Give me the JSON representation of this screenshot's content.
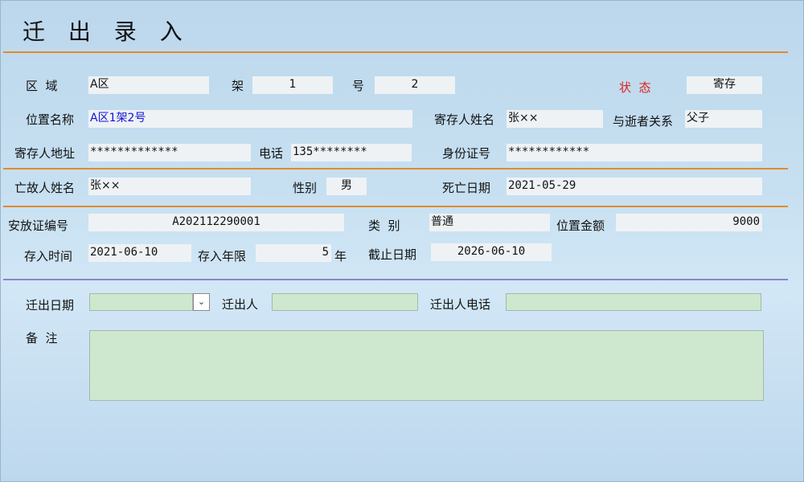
{
  "title": "迁 出 录 入",
  "row1": {
    "area_label": "区  域",
    "area_value": "A区",
    "shelf_label": "架",
    "shelf_value": "1",
    "number_label": "号",
    "number_value": "2",
    "status_label": "状  态",
    "status_value": "寄存"
  },
  "row2": {
    "position_label": "位置名称",
    "position_value": "A区1架2号",
    "depositor_label": "寄存人姓名",
    "depositor_value": "张××",
    "relation_label": "与逝者关系",
    "relation_value": "父子"
  },
  "row3": {
    "address_label": "寄存人地址",
    "address_value": "*************",
    "phone_label": "电话",
    "phone_value": "135********",
    "id_label": "身份证号",
    "id_value": "************"
  },
  "row4": {
    "deceased_label": "亡故人姓名",
    "deceased_value": "张××",
    "gender_label": "性别",
    "gender_value": "男",
    "death_label": "死亡日期",
    "death_value": "2021-05-29"
  },
  "row5": {
    "cert_label": "安放证编号",
    "cert_value": "A202112290001",
    "type_label": "类  别",
    "type_value": "普通",
    "amount_label": "位置金额",
    "amount_value": "9000"
  },
  "row6": {
    "deposit_time_label": "存入时间",
    "deposit_time_value": "2021-06-10",
    "years_label": "存入年限",
    "years_value": "5",
    "years_unit": "年",
    "end_label": "截止日期",
    "end_value": "2026-06-10"
  },
  "moveout": {
    "date_label": "迁出日期",
    "date_value": "",
    "person_label": "迁出人",
    "person_value": "",
    "phone_label": "迁出人电话",
    "phone_value": "",
    "remark_label": "备  注",
    "remark_value": ""
  },
  "colors": {
    "accent_line": "#e38a2c",
    "divider": "#8c84c8",
    "status_label": "#e0201a",
    "position_text": "#1414d4",
    "editable_bg": "#cde8cf"
  },
  "icons": {
    "date_dropdown": "dropdown-arrow-icon"
  }
}
